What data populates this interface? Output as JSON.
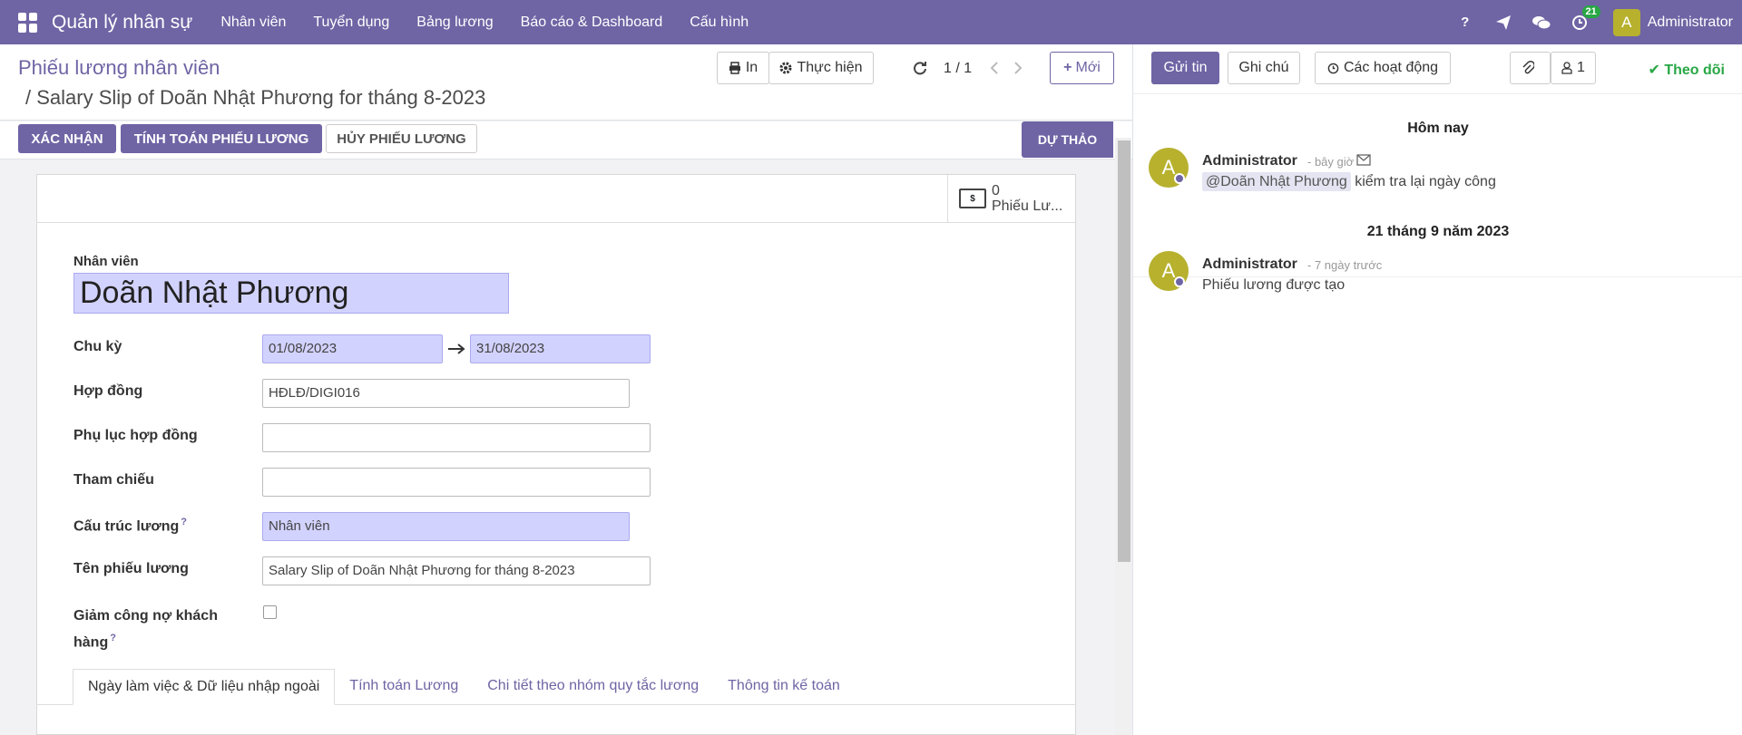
{
  "navbar": {
    "brand": "Quản lý nhân sự",
    "menu": [
      "Nhân viên",
      "Tuyển dụng",
      "Bảng lương",
      "Báo cáo & Dashboard",
      "Cấu hình"
    ],
    "activity_count": "21",
    "user_initial": "A",
    "user_name": "Administrator"
  },
  "control": {
    "breadcrumb_parent": "Phiếu lương nhân viên",
    "breadcrumb_current": "/ Salary Slip of Doãn Nhật Phương for tháng 8-2023",
    "print_label": "In",
    "action_label": "Thực hiện",
    "pager": "1 / 1",
    "new_label": "Mới"
  },
  "status": {
    "confirm_label": "XÁC NHẬN",
    "compute_label": "TÍNH TOÁN PHIẾU LƯƠNG",
    "cancel_label": "HỦY PHIẾU LƯƠNG",
    "stage_label": "DỰ THẢO"
  },
  "stat": {
    "count": "0",
    "label": "Phiếu Lư..."
  },
  "form": {
    "employee_label": "Nhân viên",
    "employee_name": "Doãn Nhật Phương",
    "period_label": "Chu kỳ",
    "date_from": "01/08/2023",
    "date_to": "31/08/2023",
    "contract_label": "Hợp đồng",
    "contract_value": "HĐLĐ/DIGI016",
    "addendum_label": "Phụ lục hợp đồng",
    "reference_label": "Tham chiếu",
    "structure_label": "Cấu trúc lương",
    "structure_value": "Nhân viên",
    "slip_name_label": "Tên phiếu lương",
    "slip_name_value": "Salary Slip of Doãn Nhật Phương for tháng 8-2023",
    "debt_label_1": "Giảm công nợ khách",
    "debt_label_2": "hàng",
    "help_mark": "?"
  },
  "tabs": [
    "Ngày làm việc & Dữ liệu nhập ngoài",
    "Tính toán Lương",
    "Chi tiết theo nhóm quy tắc lương",
    "Thông tin kế toán"
  ],
  "chatter": {
    "send_label": "Gửi tin",
    "note_label": "Ghi chú",
    "activities_label": "Các hoạt động",
    "followers_count": "1",
    "follow_label": "Theo dõi",
    "today": "Hôm nay",
    "msg1_author": "Administrator",
    "msg1_date": "- bây giờ",
    "msg1_mention": "@Doãn Nhật Phương",
    "msg1_text": "kiểm tra lại ngày công",
    "day2": "21 tháng 9 năm 2023",
    "msg2_author": "Administrator",
    "msg2_date": "- 7 ngày trước",
    "msg2_text": "Phiếu lương được tạo",
    "avatar_initial": "A"
  },
  "colors": {
    "brand": "#6f64a4",
    "required_bg": "#d2d2ff",
    "follow": "#28a745"
  }
}
